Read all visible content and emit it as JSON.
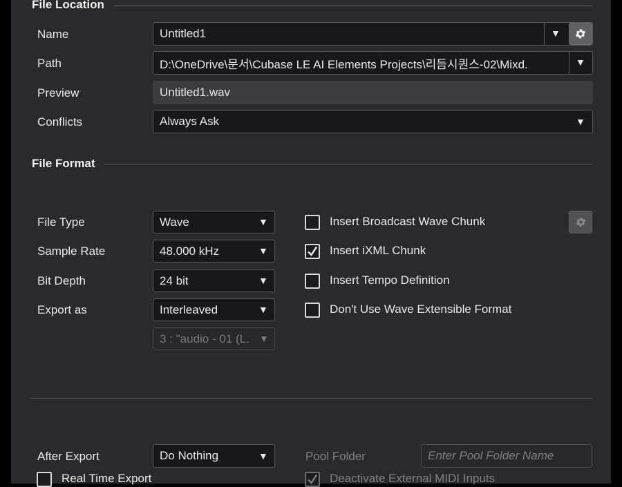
{
  "file_location": {
    "title": "File Location",
    "name_label": "Name",
    "name_value": "Untitled1",
    "path_label": "Path",
    "path_value": "D:\\OneDrive\\문서\\Cubase LE AI Elements Projects\\리듬시퀀스-02\\Mixd.",
    "preview_label": "Preview",
    "preview_value": "Untitled1.wav",
    "conflicts_label": "Conflicts",
    "conflicts_value": "Always Ask"
  },
  "file_format": {
    "title": "File Format",
    "file_type_label": "File Type",
    "file_type_value": "Wave",
    "sample_rate_label": "Sample Rate",
    "sample_rate_value": "48.000 kHz",
    "bit_depth_label": "Bit Depth",
    "bit_depth_value": "24 bit",
    "export_as_label": "Export as",
    "export_as_value": "Interleaved",
    "channel_value": "3 : \"audio - 01 (L.",
    "options": [
      {
        "label": "Insert Broadcast Wave Chunk",
        "checked": false
      },
      {
        "label": "Insert iXML Chunk",
        "checked": true
      },
      {
        "label": "Insert Tempo Definition",
        "checked": false
      },
      {
        "label": "Don't Use Wave Extensible Format",
        "checked": false
      }
    ]
  },
  "post_process": {
    "after_export_label": "After Export",
    "after_export_value": "Do Nothing",
    "pool_folder_label": "Pool Folder",
    "pool_folder_placeholder": "Enter Pool Folder Name",
    "real_time_export_label": "Real Time Export",
    "real_time_export_checked": false,
    "deactivate_midi_label": "Deactivate External MIDI Inputs",
    "deactivate_midi_checked": true
  },
  "colors": {
    "background": "#282a2d",
    "field": "#16181b",
    "readonly_field": "#3a3c3f",
    "text": "#eaeaea",
    "disabled_text": "#7f8185"
  },
  "icons": {
    "dropdown": "chevron-down-icon",
    "settings": "gear-icon",
    "check": "check-icon"
  }
}
